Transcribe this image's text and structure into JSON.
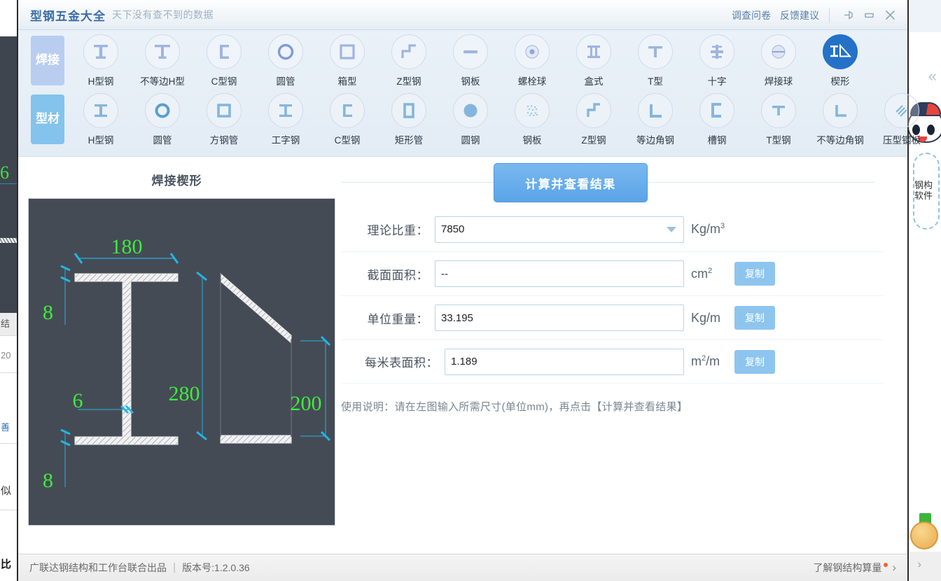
{
  "window": {
    "title": "型钢五金大全",
    "subtitle": "天下没有查不到的数据",
    "survey_link": "调查问卷",
    "feedback_link": "反馈建议",
    "pin_icon": "pin-icon",
    "minimize_icon": "minimize-icon",
    "close_icon": "close-icon"
  },
  "toolbar": {
    "rows": [
      {
        "category": "焊接",
        "items": [
          {
            "label": "H型钢",
            "icon": "h-beam-icon",
            "active": false
          },
          {
            "label": "不等边H型",
            "icon": "unequal-h-icon",
            "active": false
          },
          {
            "label": "C型钢",
            "icon": "c-channel-icon",
            "active": false
          },
          {
            "label": "圆管",
            "icon": "round-pipe-icon",
            "active": false
          },
          {
            "label": "箱型",
            "icon": "box-section-icon",
            "active": false
          },
          {
            "label": "Z型钢",
            "icon": "z-section-icon",
            "active": false
          },
          {
            "label": "钢板",
            "icon": "steel-plate-icon",
            "active": false
          },
          {
            "label": "螺栓球",
            "icon": "bolt-ball-icon",
            "active": false
          },
          {
            "label": "盒式",
            "icon": "box-type-icon",
            "active": false
          },
          {
            "label": "T型",
            "icon": "t-section-icon",
            "active": false
          },
          {
            "label": "十字",
            "icon": "cross-section-icon",
            "active": false
          },
          {
            "label": "焊接球",
            "icon": "weld-ball-icon",
            "active": false
          },
          {
            "label": "楔形",
            "icon": "wedge-icon",
            "active": true
          }
        ]
      },
      {
        "category": "型材",
        "items": [
          {
            "label": "H型钢",
            "icon": "h-beam-icon",
            "active": false
          },
          {
            "label": "圆管",
            "icon": "round-pipe-icon",
            "active": false
          },
          {
            "label": "方钢管",
            "icon": "square-tube-icon",
            "active": false
          },
          {
            "label": "工字钢",
            "icon": "i-beam-icon",
            "active": false
          },
          {
            "label": "C型钢",
            "icon": "c-channel-icon",
            "active": false
          },
          {
            "label": "矩形管",
            "icon": "rect-tube-icon",
            "active": false
          },
          {
            "label": "圆钢",
            "icon": "round-bar-icon",
            "active": false
          },
          {
            "label": "钢板",
            "icon": "steel-plate-tex-icon",
            "active": false
          },
          {
            "label": "Z型钢",
            "icon": "z-section-icon",
            "active": false
          },
          {
            "label": "等边角钢",
            "icon": "equal-angle-icon",
            "active": false
          },
          {
            "label": "槽钢",
            "icon": "channel-icon",
            "active": false
          },
          {
            "label": "T型钢",
            "icon": "t-beam-icon",
            "active": false
          },
          {
            "label": "不等边角钢",
            "icon": "unequal-angle-icon",
            "active": false
          },
          {
            "label": "压型钢板",
            "icon": "corrugated-plate-icon",
            "active": false
          }
        ]
      }
    ]
  },
  "figure": {
    "title": "焊接楔形",
    "dims": {
      "flange_width": "180",
      "flange_thickness_top": "8",
      "web_thickness": "6",
      "height_left": "280",
      "height_right": "200",
      "flange_thickness_bottom": "8"
    },
    "colors": {
      "dimension_text": "#3dec3d",
      "dimension_line": "#2b9fc9",
      "background": "#454b55"
    }
  },
  "form": {
    "calc_button": "计算并查看结果",
    "copy_label": "复制",
    "fields": [
      {
        "label": "理论比重：",
        "value": "7850",
        "unit_main": "Kg/m",
        "unit_sup": "3",
        "type": "select",
        "has_copy": false
      },
      {
        "label": "截面面积：",
        "value": "--",
        "unit_main": "cm",
        "unit_sup": "2",
        "type": "text",
        "has_copy": true
      },
      {
        "label": "单位重量：",
        "value": "33.195",
        "unit_main": "Kg/m",
        "unit_sup": "",
        "type": "text",
        "has_copy": true
      },
      {
        "label": "每米表面积：",
        "value": "1.189",
        "unit_main": "m",
        "unit_sup": "2",
        "unit_tail": "/m",
        "type": "text",
        "has_copy": true
      }
    ],
    "hint": "使用说明：请在左图输入所需尺寸(单位mm)，再点击【计算并查看结果】"
  },
  "footer": {
    "producer": "广联达钢结构和工作台联合出品",
    "separator": "|",
    "version": "版本号:1.2.0.36",
    "right_link": "了解钢结构算量"
  },
  "side_widget": {
    "bubble_text": "钢构软件"
  }
}
